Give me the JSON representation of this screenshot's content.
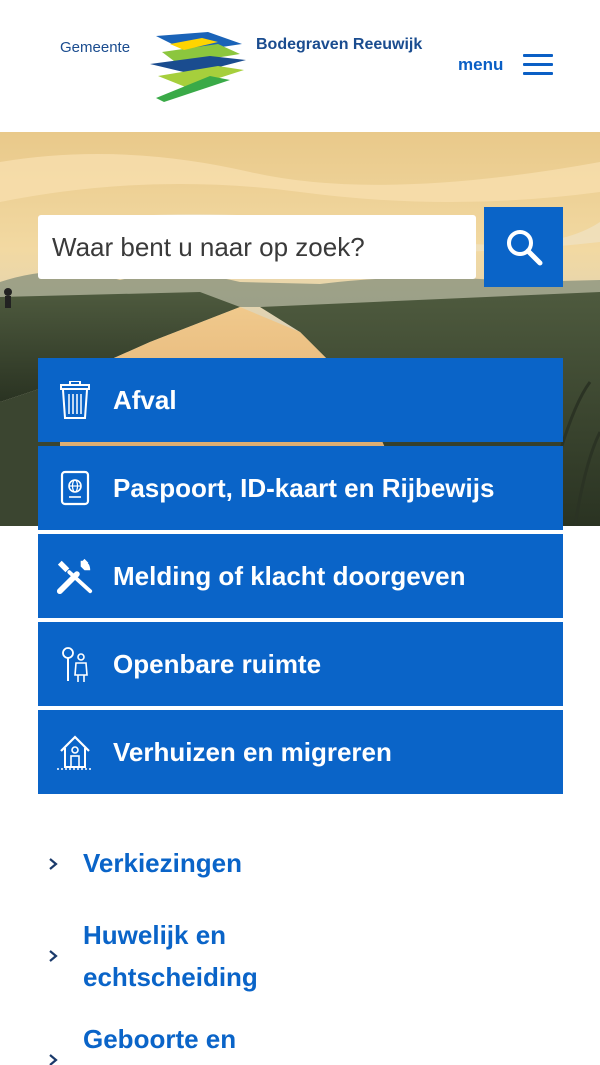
{
  "header": {
    "logo": {
      "prefix": "Gemeente",
      "name": "Bodegraven Reeuwijk"
    },
    "menu_label": "menu",
    "hamburger_icon": "hamburger-icon"
  },
  "search": {
    "placeholder": "Waar bent u naar op zoek?",
    "button_icon": "search-icon"
  },
  "tiles": [
    {
      "label": "Afval",
      "icon": "trash-bin-icon"
    },
    {
      "label": "Paspoort, ID-kaart en Rijbewijs",
      "icon": "passport-icon"
    },
    {
      "label": "Melding of klacht doorgeven",
      "icon": "tools-icon"
    },
    {
      "label": "Openbare ruimte",
      "icon": "park-icon"
    },
    {
      "label": "Verhuizen en migreren",
      "icon": "house-icon"
    }
  ],
  "links": [
    {
      "label": "Verkiezingen"
    },
    {
      "label": "Huwelijk en echtscheiding"
    },
    {
      "label": "Geboorte en overlijden"
    }
  ],
  "colors": {
    "primary_blue": "#0a64c8",
    "logo_blue": "#1a4c8f",
    "white": "#ffffff"
  }
}
